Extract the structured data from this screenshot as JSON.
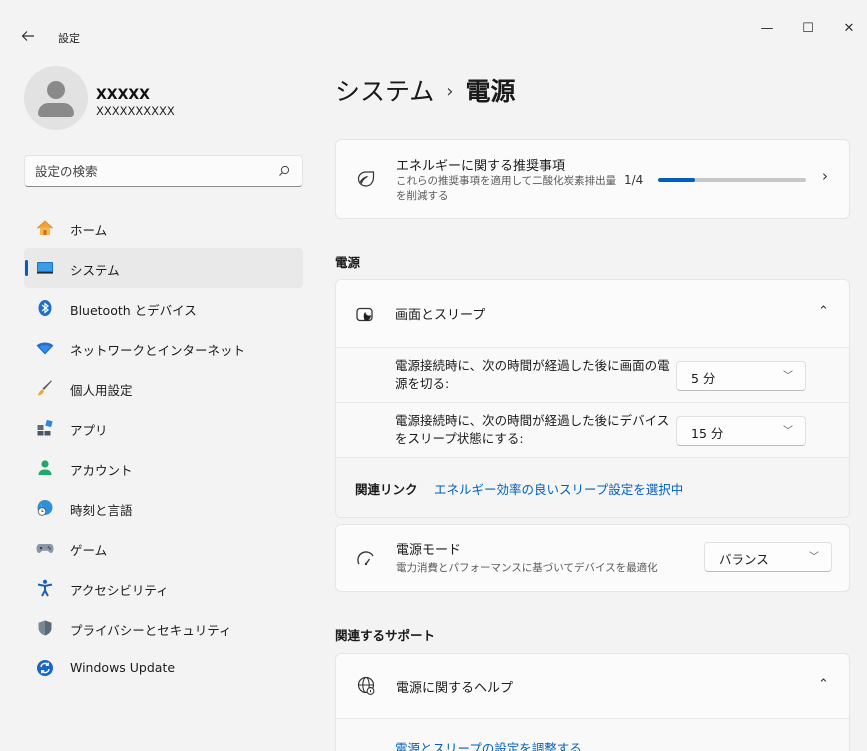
{
  "titlebar": {
    "back_icon": "arrow-left-icon",
    "app_title": "設定",
    "minimize": "—",
    "maximize": "☐",
    "close": "✕"
  },
  "profile": {
    "name": "XXXXX",
    "email": "XXXXXXXXXX"
  },
  "search": {
    "placeholder": "設定の検索"
  },
  "sidebar": {
    "items": [
      {
        "label": "ホーム",
        "icon": "home-icon",
        "active": false
      },
      {
        "label": "システム",
        "icon": "monitor-icon",
        "active": true
      },
      {
        "label": "Bluetooth とデバイス",
        "icon": "bluetooth-icon",
        "active": false
      },
      {
        "label": "ネットワークとインターネット",
        "icon": "wifi-icon",
        "active": false
      },
      {
        "label": "個人用設定",
        "icon": "brush-icon",
        "active": false
      },
      {
        "label": "アプリ",
        "icon": "apps-icon",
        "active": false
      },
      {
        "label": "アカウント",
        "icon": "person-icon",
        "active": false
      },
      {
        "label": "時刻と言語",
        "icon": "globe-clock-icon",
        "active": false
      },
      {
        "label": "ゲーム",
        "icon": "gamepad-icon",
        "active": false
      },
      {
        "label": "アクセシビリティ",
        "icon": "accessibility-icon",
        "active": false
      },
      {
        "label": "プライバシーとセキュリティ",
        "icon": "shield-icon",
        "active": false
      },
      {
        "label": "Windows Update",
        "icon": "update-icon",
        "active": false
      }
    ]
  },
  "breadcrumb": {
    "parent": "システム",
    "separator": "›",
    "current": "電源"
  },
  "recommendation": {
    "title": "エネルギーに関する推奨事項",
    "description": "これらの推奨事項を適用して二酸化炭素排出量を削減する",
    "count": "1/4",
    "progress": 0.25,
    "chevron": "›"
  },
  "sections": {
    "power": "電源",
    "related_support": "関連するサポート"
  },
  "screen_sleep": {
    "title": "画面とスリープ",
    "chevron": "⌃",
    "rows": [
      {
        "label": "電源接続時に、次の時間が経過した後に画面の電源を切る:",
        "value": "5 分"
      },
      {
        "label": "電源接続時に、次の時間が経過した後にデバイスをスリープ状態にする:",
        "value": "15 分"
      }
    ],
    "related_label": "関連リンク",
    "related_link": "エネルギー効率の良いスリープ設定を選択中"
  },
  "power_mode": {
    "title": "電源モード",
    "description": "電力消費とパフォーマンスに基づいてデバイスを最適化",
    "value": "バランス"
  },
  "help": {
    "title": "電源に関するヘルプ",
    "chevron": "⌃",
    "link": "電源とスリープの設定を調整する"
  },
  "colors": {
    "accent": "#005fb8",
    "background": "#f3f3f3",
    "card": "#fbfbfb"
  }
}
